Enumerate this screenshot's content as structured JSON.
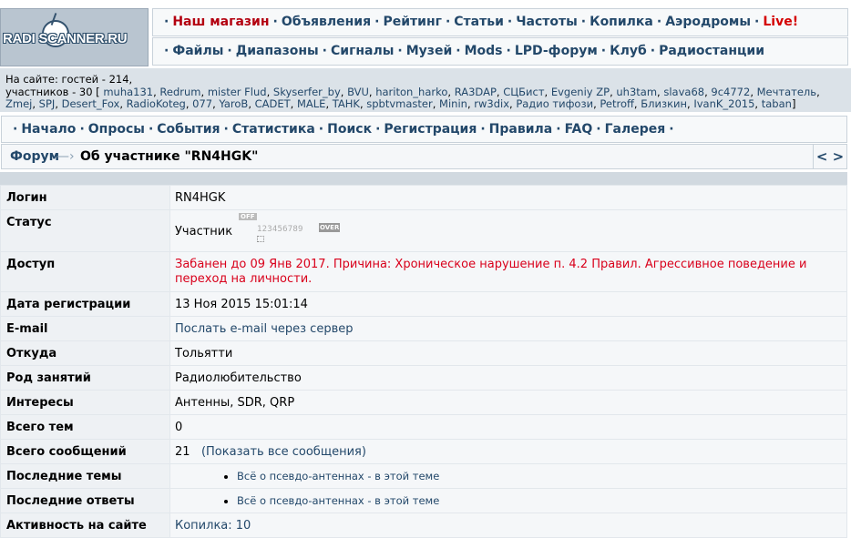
{
  "logo": {
    "text": "RADI  SCANNER.RU"
  },
  "nav_top": [
    {
      "label": "Наш магазин",
      "style": "red"
    },
    {
      "label": "Объявления"
    },
    {
      "label": "Рейтинг"
    },
    {
      "label": "Статьи"
    },
    {
      "label": "Частоты"
    },
    {
      "label": "Копилка"
    },
    {
      "label": "Аэродромы"
    },
    {
      "label": "Live!",
      "style": "brightred"
    }
  ],
  "nav_second": [
    "Файлы",
    "Диапазоны",
    "Сигналы",
    "Музей",
    "Mods",
    "LPD-форум",
    "Клуб",
    "Радиостанции"
  ],
  "online": {
    "guests": "На сайте: гостей - 214,",
    "members_prefix": "участников - 30 [",
    "members_suffix": "]",
    "users": [
      "muha131",
      "Redrum",
      "mister Flud",
      "Skyserfer_by",
      "BVU",
      "hariton_harko",
      "RA3DAP",
      "СЦБист",
      "Evgeniy ZP",
      "uh3tam",
      "slava68",
      "9c4772",
      "Мечтатель",
      "Zmej",
      "SPJ",
      "Desert_Fox",
      "RadioKoteg",
      "077",
      "YaroB",
      "CADET",
      "MALE",
      "TAHK",
      "spbtvmaster",
      "Minin",
      "rw3dix",
      "Радио тифози",
      "Petroff",
      "Близкин",
      "IvanK_2015",
      "taban"
    ]
  },
  "nav_forum": [
    "Начало",
    "Опросы",
    "События",
    "Статистика",
    "Поиск",
    "Регистрация",
    "Правила",
    "FAQ",
    "Галерея"
  ],
  "breadcrumb": {
    "home": "Форум",
    "arrow": "—›",
    "current": "Об участнике \"RN4HGK\"",
    "pager": "< >"
  },
  "meter": {
    "off": "OFF",
    "nums": "123456789",
    "over": "OVER"
  },
  "profile": {
    "login_label": "Логин",
    "login": "RN4HGK",
    "status_label": "Статус",
    "status": "Участник",
    "access_label": "Доступ",
    "access": "Забанен до 09 Янв 2017. Причина: Хроническое нарушение п. 4.2 Правил. Агрессивное поведение и переход на личности.",
    "reg_label": "Дата регистрации",
    "reg": "13 Ноя 2015 15:01:14",
    "email_label": "E-mail",
    "email": "Послать e-mail через сервер",
    "from_label": "Откуда",
    "from": "Тольятти",
    "occupation_label": "Род занятий",
    "occupation": "Радиолюбительство",
    "interests_label": "Интересы",
    "interests": "Антенны, SDR, QRP",
    "topics_label": "Всего тем",
    "topics": "0",
    "posts_label": "Всего сообщений",
    "posts": "21",
    "posts_link": "(Показать все сообщения)",
    "last_topics_label": "Последние темы",
    "last_topics": "Всё о псевдо-антеннах - в этой теме",
    "last_replies_label": "Последние ответы",
    "last_replies": "Всё о псевдо-антеннах - в этой теме",
    "activity_label": "Активность на сайте",
    "activity": "Копилка: 10"
  }
}
